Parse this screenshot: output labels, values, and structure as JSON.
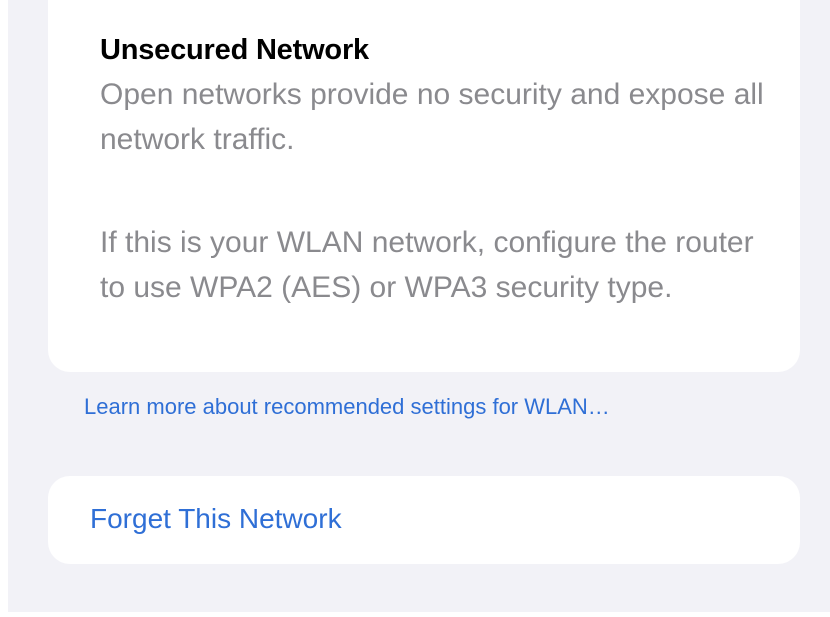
{
  "warning": {
    "title": "Unsecured Network",
    "paragraph1": "Open networks provide no security and expose all network traffic.",
    "paragraph2": "If this is your WLAN network, configure the router to use WPA2 (AES) or WPA3 security type."
  },
  "learn_more_link": "Learn more about recommended settings for WLAN…",
  "forget_button": "Forget This Network",
  "colors": {
    "accent": "#2f6fd6",
    "secondary_text": "#8a8a8e",
    "grouped_background": "#f2f2f7",
    "card_background": "#ffffff"
  }
}
